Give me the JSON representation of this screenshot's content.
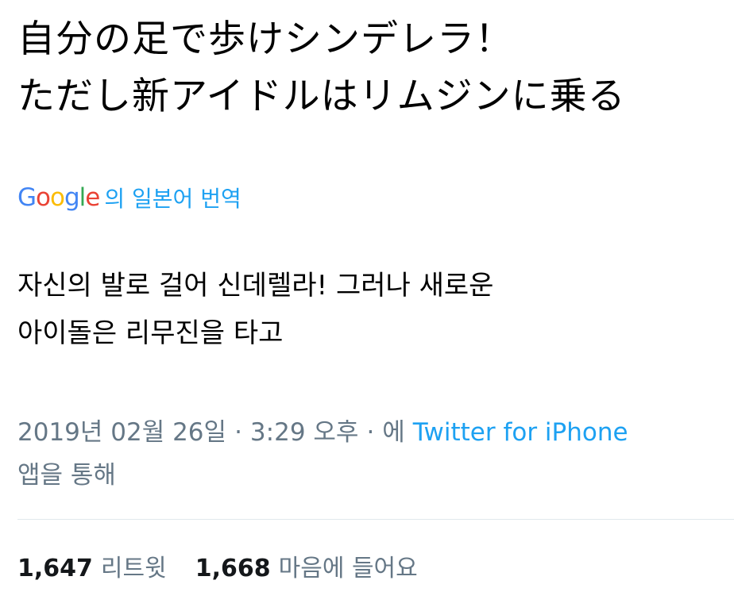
{
  "tweet": {
    "original_lines": [
      "自分の足で歩けシンデレラ！",
      "ただし新アイドルはリムジンに乗る"
    ],
    "translate_credit": {
      "logo_letters": [
        "G",
        "o",
        "o",
        "g",
        "l",
        "e"
      ],
      "label": "의 일본어 번역"
    },
    "translation_lines": [
      "자신의 발로 걸어 신데렐라! 그러나 새로운",
      "아이돌은 리무진을 타고"
    ],
    "meta": {
      "date": "2019년 02월 26일",
      "separator": "·",
      "time": "3:29 오후",
      "via_prefix": "에",
      "source": "Twitter for iPhone",
      "via_suffix": "앱을 통해"
    },
    "stats": {
      "retweets_count": "1,647",
      "retweets_label": "리트윗",
      "likes_count": "1,668",
      "likes_label": "마음에 들어요"
    },
    "colors": {
      "link": "#1da1f2",
      "muted": "#657786",
      "divider": "#e1e8ed"
    }
  }
}
